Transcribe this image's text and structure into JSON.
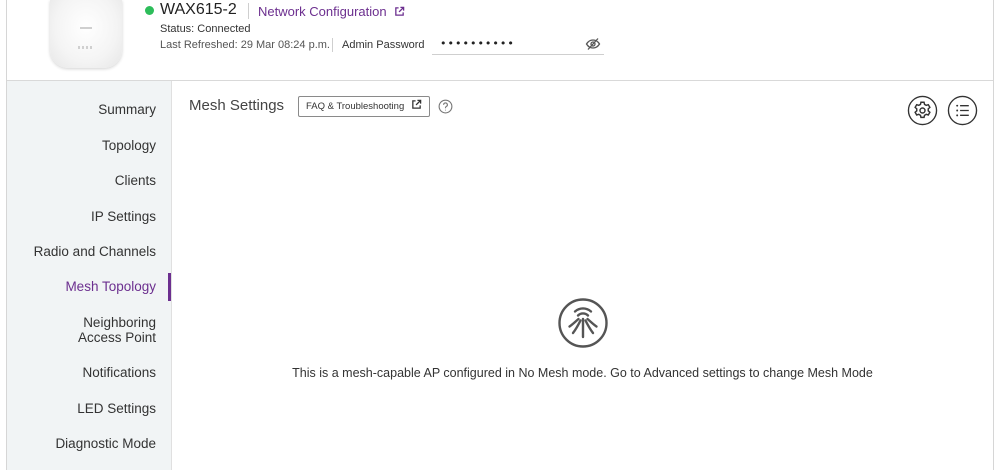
{
  "device": {
    "name": "WAX615-2",
    "network_config_link": "Network Configuration",
    "status_text": "Status: Connected",
    "last_refreshed": "Last Refreshed: 29 Mar 08:24 p.m.",
    "admin_password_label": "Admin Password",
    "admin_password_value": "••••••••••",
    "status_color": "#2dbd5a"
  },
  "sidebar": {
    "items": [
      {
        "label": "Summary"
      },
      {
        "label": "Topology"
      },
      {
        "label": "Clients"
      },
      {
        "label": "IP Settings"
      },
      {
        "label": "Radio and Channels"
      },
      {
        "label": "Mesh Topology",
        "active": true
      },
      {
        "label": "Neighboring Access Point"
      },
      {
        "label": "Notifications"
      },
      {
        "label": "LED Settings"
      },
      {
        "label": "Diagnostic Mode"
      }
    ]
  },
  "main": {
    "title": "Mesh Settings",
    "faq_button": "FAQ & Troubleshooting",
    "message": "This is a mesh-capable AP configured in No Mesh mode. Go to Advanced settings to change Mesh Mode"
  },
  "icons": {
    "external_link": "external-link-icon",
    "eye_hidden": "eye-off-icon",
    "help": "help-icon",
    "settings": "gear-icon",
    "list": "list-icon",
    "mesh": "mesh-icon"
  },
  "colors": {
    "accent": "#6c2f8f",
    "sidebar_bg": "#f1f4f5"
  }
}
